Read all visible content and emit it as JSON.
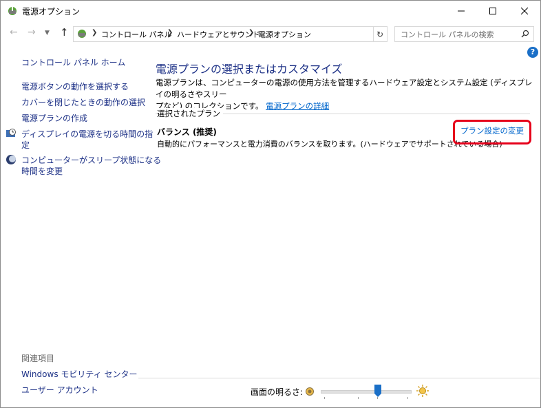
{
  "window": {
    "title": "電源オプション",
    "icon": "power-options-icon",
    "controls": [
      "minimize-icon",
      "maximize-icon",
      "close-icon"
    ]
  },
  "address_bar": {
    "crumbs": [
      "コントロール パネル",
      "ハードウェアとサウンド",
      "電源オプション"
    ],
    "search_placeholder": "コントロール パネルの検索"
  },
  "left_pane": {
    "home": "コントロール パネル ホーム",
    "links": [
      "電源ボタンの動作を選択する",
      "カバーを閉じたときの動作の選択",
      "電源プランの作成",
      "ディスプレイの電源を切る時間の指定",
      "コンピューターがスリープ状態になる時間を変更"
    ],
    "link_display_lines": {
      "l3a": "ディスプレイの電源を切る時間の指",
      "l3b": "定",
      "l4a": "コンピューターがスリープ状態になる",
      "l4b": "時間を変更"
    },
    "related_title": "関連項目",
    "related": [
      "Windows モビリティ センター",
      "ユーザー アカウント"
    ]
  },
  "main": {
    "title": "電源プランの選択またはカスタマイズ",
    "description": "電源プランは、コンピューターの電源の使用方法を管理するハードウェア設定とシステム設定 (ディスプレイの明るさやスリープなど) のコレクションです。",
    "description_line1": "電源プランは、コンピューターの電源の使用方法を管理するハードウェア設定とシステム設定 (ディスプレイの明るさやスリー",
    "description_line2": "プなど) のコレクションです。",
    "details_link": "電源プランの詳細",
    "selected_plan_label": "選択されたプラン",
    "plan": {
      "name": "バランス (推奨)",
      "description": "自動的にパフォーマンスと電力消費のバランスを取ります。(ハードウェアでサポートされている場合)",
      "change_link": "プラン設定の変更"
    }
  },
  "brightness": {
    "label": "画面の明るさ:",
    "level_fraction": 0.64
  },
  "colors": {
    "link": "#1e3287",
    "hyperlink": "#0066cc",
    "highlight": "#e6001a",
    "slider_thumb": "#1a6fc7"
  }
}
